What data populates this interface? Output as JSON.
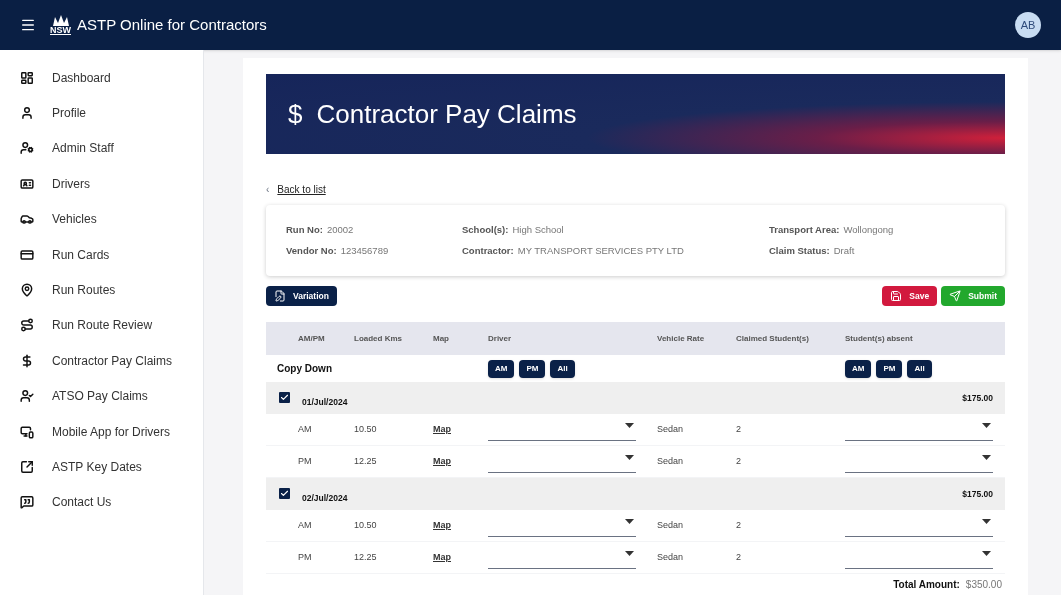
{
  "header": {
    "title": "ASTP Online for Contractors",
    "logo_text": "NSW",
    "avatar": "AB"
  },
  "sidebar": {
    "items": [
      {
        "label": "Dashboard"
      },
      {
        "label": "Profile"
      },
      {
        "label": "Admin Staff"
      },
      {
        "label": "Drivers"
      },
      {
        "label": "Vehicles"
      },
      {
        "label": "Run Cards"
      },
      {
        "label": "Run Routes"
      },
      {
        "label": "Run Route Review"
      },
      {
        "label": "Contractor Pay Claims"
      },
      {
        "label": "ATSO Pay Claims"
      },
      {
        "label": "Mobile App for Drivers"
      },
      {
        "label": "ASTP Key Dates"
      },
      {
        "label": "Contact Us"
      }
    ]
  },
  "banner": {
    "symbol": "$",
    "title": "Contractor Pay Claims"
  },
  "back_link": {
    "arrow": "‹",
    "label": "Back to list"
  },
  "info": [
    {
      "label": "Run No:",
      "value": "20002"
    },
    {
      "label": "School(s):",
      "value": "High School"
    },
    {
      "label": "Transport Area:",
      "value": "Wollongong"
    },
    {
      "label": "Vendor No:",
      "value": "123456789"
    },
    {
      "label": "Contractor:",
      "value": "MY TRANSPORT SERVICES PTY LTD"
    },
    {
      "label": "Claim Status:",
      "value": "Draft"
    }
  ],
  "actions": {
    "variation": "Variation",
    "save": "Save",
    "submit": "Submit"
  },
  "table": {
    "columns": [
      "AM/PM",
      "Loaded Kms",
      "Map",
      "Driver",
      "Vehicle Rate",
      "Claimed Student(s)",
      "Student(s) absent"
    ],
    "copy_down": {
      "label": "Copy Down",
      "driver_buttons": [
        "AM",
        "PM",
        "All"
      ],
      "absent_buttons": [
        "AM",
        "PM",
        "All"
      ]
    },
    "days": [
      {
        "date": "01/Jul/2024",
        "checked": true,
        "amount": "$175.00",
        "rows": [
          {
            "period": "AM",
            "loaded_kms": "10.50",
            "map": "Map",
            "vehicle_rate": "Sedan",
            "claimed": "2"
          },
          {
            "period": "PM",
            "loaded_kms": "12.25",
            "map": "Map",
            "vehicle_rate": "Sedan",
            "claimed": "2"
          }
        ]
      },
      {
        "date": "02/Jul/2024",
        "checked": true,
        "amount": "$175.00",
        "rows": [
          {
            "period": "AM",
            "loaded_kms": "10.50",
            "map": "Map",
            "vehicle_rate": "Sedan",
            "claimed": "2"
          },
          {
            "period": "PM",
            "loaded_kms": "12.25",
            "map": "Map",
            "vehicle_rate": "Sedan",
            "claimed": "2"
          }
        ]
      }
    ],
    "total": {
      "label": "Total Amount:",
      "value": "$350.00"
    }
  }
}
